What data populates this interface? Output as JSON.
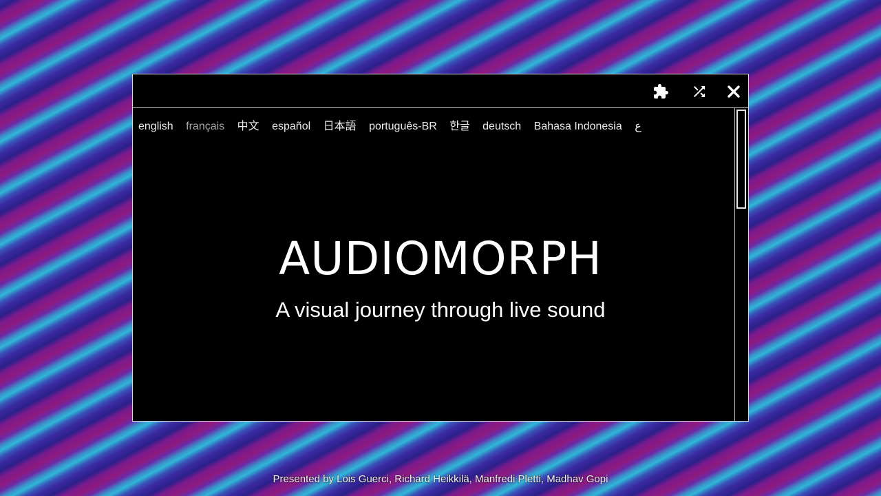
{
  "app": {
    "title": "AUDIOMORPH",
    "subtitle": "A visual journey through live sound"
  },
  "toolbar": {
    "buttons": [
      {
        "name": "puzzle-icon"
      },
      {
        "name": "shuffle-icon"
      },
      {
        "name": "close-icon"
      }
    ]
  },
  "languages": [
    {
      "label": "english",
      "selected": true
    },
    {
      "label": "français",
      "selected": false
    },
    {
      "label": "中文",
      "selected": false
    },
    {
      "label": "español",
      "selected": false
    },
    {
      "label": "日本語",
      "selected": false
    },
    {
      "label": "português-BR",
      "selected": false
    },
    {
      "label": "한글",
      "selected": false
    },
    {
      "label": "deutsch",
      "selected": false
    },
    {
      "label": "Bahasa Indonesia",
      "selected": false
    },
    {
      "label": "ع",
      "selected": false
    }
  ],
  "footer": {
    "credits": "Presented by Lois Guerci, Richard Heikkilä, Manfredi Pletti, Madhav Gopi"
  },
  "colors": {
    "background_accent_1": "#8e1a7e",
    "background_accent_2": "#2fb7d8",
    "background_accent_3": "#3a2aa0",
    "window_bg": "#000000",
    "text": "#ffffff"
  }
}
